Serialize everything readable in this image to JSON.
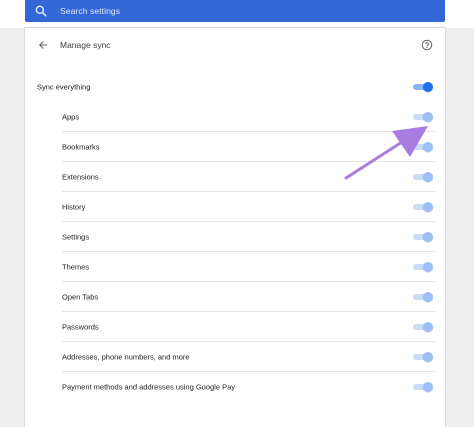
{
  "search": {
    "placeholder": "Search settings"
  },
  "header": {
    "title": "Manage sync"
  },
  "sync_everything": {
    "label": "Sync everything",
    "enabled": true
  },
  "items": [
    {
      "label": "Apps",
      "enabled": true
    },
    {
      "label": "Bookmarks",
      "enabled": true
    },
    {
      "label": "Extensions",
      "enabled": true
    },
    {
      "label": "History",
      "enabled": true
    },
    {
      "label": "Settings",
      "enabled": true
    },
    {
      "label": "Themes",
      "enabled": true
    },
    {
      "label": "Open Tabs",
      "enabled": true
    },
    {
      "label": "Passwords",
      "enabled": true
    },
    {
      "label": "Addresses, phone numbers, and more",
      "enabled": true
    },
    {
      "label": "Payment methods and addresses using Google Pay",
      "enabled": true
    }
  ],
  "colors": {
    "searchbar": "#3367d6",
    "toggle_on": "#1a73e8",
    "toggle_disabled": "#9cc0f6",
    "annotation_arrow": "#a77ee0"
  },
  "icons": [
    "search-icon",
    "back-arrow-icon",
    "help-icon"
  ]
}
